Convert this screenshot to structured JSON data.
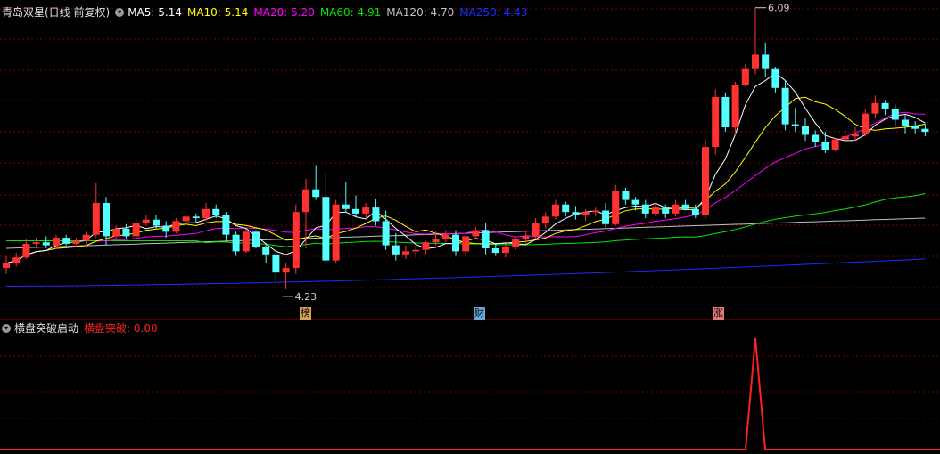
{
  "main_header": {
    "title": "青岛双星(日线 前复权)",
    "ma5": "MA5: 5.14",
    "ma10": "MA10: 5.14",
    "ma20": "MA20: 5.20",
    "ma60": "MA60: 4.91",
    "ma120": "MA120: 4.70",
    "ma250": "MA250: 4.43"
  },
  "sub_header": {
    "title": "横盘突破启动",
    "indicator": "横盘突破: 0.00"
  },
  "badges": [
    {
      "label": "榜",
      "color": "#d8a15c"
    },
    {
      "label": "财",
      "color": "#6aa6d8"
    },
    {
      "label": "涨",
      "color": "#e07a7a"
    }
  ],
  "colors": {
    "up": "#ff3232",
    "down": "#54ffff",
    "ma5": "#ffffff",
    "ma10": "#ffff00",
    "ma20": "#ff00ff",
    "ma60": "#00e600",
    "ma120": "#c0c0c0",
    "ma250": "#1a2cff",
    "grid": "#7a0000",
    "signal": "#ff2020"
  },
  "chart_data": [
    {
      "type": "candlestick",
      "title": "青岛双星(日线 前复权)",
      "annotations": [
        {
          "text": "6.09",
          "kind": "high",
          "value": 6.09
        },
        {
          "text": "4.23",
          "kind": "low",
          "value": 4.23
        }
      ],
      "price_range": [
        4.1,
        6.2
      ],
      "ohlc": [
        [
          4.37,
          4.45,
          4.33,
          4.4
        ],
        [
          4.4,
          4.47,
          4.38,
          4.44
        ],
        [
          4.44,
          4.56,
          4.43,
          4.53
        ],
        [
          4.53,
          4.57,
          4.5,
          4.54
        ],
        [
          4.54,
          4.58,
          4.5,
          4.52
        ],
        [
          4.52,
          4.59,
          4.5,
          4.57
        ],
        [
          4.57,
          4.59,
          4.52,
          4.53
        ],
        [
          4.53,
          4.57,
          4.51,
          4.55
        ],
        [
          4.55,
          4.61,
          4.53,
          4.59
        ],
        [
          4.59,
          4.93,
          4.57,
          4.8
        ],
        [
          4.8,
          4.84,
          4.52,
          4.58
        ],
        [
          4.58,
          4.65,
          4.56,
          4.63
        ],
        [
          4.63,
          4.66,
          4.56,
          4.58
        ],
        [
          4.58,
          4.7,
          4.57,
          4.67
        ],
        [
          4.67,
          4.72,
          4.65,
          4.69
        ],
        [
          4.69,
          4.72,
          4.63,
          4.65
        ],
        [
          4.65,
          4.68,
          4.57,
          4.61
        ],
        [
          4.61,
          4.7,
          4.6,
          4.68
        ],
        [
          4.68,
          4.73,
          4.67,
          4.71
        ],
        [
          4.71,
          4.73,
          4.67,
          4.7
        ],
        [
          4.7,
          4.8,
          4.68,
          4.76
        ],
        [
          4.76,
          4.79,
          4.7,
          4.72
        ],
        [
          4.72,
          4.74,
          4.55,
          4.59
        ],
        [
          4.59,
          4.61,
          4.45,
          4.48
        ],
        [
          4.48,
          4.63,
          4.47,
          4.61
        ],
        [
          4.61,
          4.62,
          4.5,
          4.51
        ],
        [
          4.51,
          4.53,
          4.4,
          4.46
        ],
        [
          4.46,
          4.48,
          4.3,
          4.34
        ],
        [
          4.34,
          4.4,
          4.23,
          4.37
        ],
        [
          4.37,
          4.79,
          4.33,
          4.74
        ],
        [
          4.74,
          4.96,
          4.5,
          4.89
        ],
        [
          4.89,
          5.05,
          4.82,
          4.84
        ],
        [
          4.84,
          5.01,
          4.4,
          4.42
        ],
        [
          4.42,
          4.82,
          4.4,
          4.79
        ],
        [
          4.79,
          4.94,
          4.74,
          4.76
        ],
        [
          4.76,
          4.85,
          4.71,
          4.73
        ],
        [
          4.73,
          4.8,
          4.7,
          4.77
        ],
        [
          4.77,
          4.83,
          4.65,
          4.68
        ],
        [
          4.68,
          4.75,
          4.49,
          4.52
        ],
        [
          4.52,
          4.6,
          4.42,
          4.46
        ],
        [
          4.46,
          4.52,
          4.43,
          4.48
        ],
        [
          4.48,
          4.52,
          4.44,
          4.49
        ],
        [
          4.49,
          4.55,
          4.46,
          4.54
        ],
        [
          4.54,
          4.61,
          4.52,
          4.56
        ],
        [
          4.56,
          4.62,
          4.54,
          4.59
        ],
        [
          4.59,
          4.62,
          4.45,
          4.48
        ],
        [
          4.48,
          4.6,
          4.45,
          4.58
        ],
        [
          4.58,
          4.64,
          4.56,
          4.62
        ],
        [
          4.62,
          4.67,
          4.46,
          4.5
        ],
        [
          4.5,
          4.53,
          4.45,
          4.47
        ],
        [
          4.47,
          4.53,
          4.44,
          4.51
        ],
        [
          4.51,
          4.58,
          4.49,
          4.56
        ],
        [
          4.56,
          4.62,
          4.53,
          4.58
        ],
        [
          4.58,
          4.7,
          4.56,
          4.67
        ],
        [
          4.67,
          4.74,
          4.63,
          4.71
        ],
        [
          4.71,
          4.82,
          4.69,
          4.79
        ],
        [
          4.79,
          4.81,
          4.71,
          4.74
        ],
        [
          4.74,
          4.78,
          4.69,
          4.72
        ],
        [
          4.72,
          4.76,
          4.68,
          4.74
        ],
        [
          4.74,
          4.77,
          4.71,
          4.75
        ],
        [
          4.75,
          4.8,
          4.64,
          4.66
        ],
        [
          4.66,
          4.92,
          4.65,
          4.88
        ],
        [
          4.88,
          4.9,
          4.79,
          4.82
        ],
        [
          4.82,
          4.84,
          4.75,
          4.79
        ],
        [
          4.79,
          4.82,
          4.7,
          4.73
        ],
        [
          4.73,
          4.8,
          4.71,
          4.77
        ],
        [
          4.77,
          4.79,
          4.7,
          4.73
        ],
        [
          4.73,
          4.82,
          4.71,
          4.79
        ],
        [
          4.79,
          4.82,
          4.75,
          4.76
        ],
        [
          4.76,
          4.79,
          4.7,
          4.72
        ],
        [
          4.72,
          5.22,
          4.7,
          5.17
        ],
        [
          5.17,
          5.55,
          5.12,
          5.5
        ],
        [
          5.5,
          5.53,
          5.27,
          5.3
        ],
        [
          5.3,
          5.6,
          5.25,
          5.58
        ],
        [
          5.58,
          5.72,
          5.57,
          5.69
        ],
        [
          5.69,
          6.09,
          5.65,
          5.78
        ],
        [
          5.78,
          5.86,
          5.63,
          5.69
        ],
        [
          5.69,
          5.7,
          5.53,
          5.56
        ],
        [
          5.56,
          5.61,
          5.28,
          5.32
        ],
        [
          5.32,
          5.43,
          5.27,
          5.31
        ],
        [
          5.31,
          5.36,
          5.21,
          5.25
        ],
        [
          5.25,
          5.28,
          5.17,
          5.2
        ],
        [
          5.2,
          5.27,
          5.13,
          5.15
        ],
        [
          5.15,
          5.23,
          5.14,
          5.22
        ],
        [
          5.22,
          5.28,
          5.2,
          5.24
        ],
        [
          5.24,
          5.3,
          5.21,
          5.26
        ],
        [
          5.26,
          5.42,
          5.24,
          5.39
        ],
        [
          5.39,
          5.51,
          5.36,
          5.46
        ],
        [
          5.46,
          5.48,
          5.38,
          5.42
        ],
        [
          5.42,
          5.45,
          5.31,
          5.35
        ],
        [
          5.35,
          5.38,
          5.26,
          5.31
        ],
        [
          5.31,
          5.34,
          5.26,
          5.29
        ],
        [
          5.29,
          5.32,
          5.24,
          5.27
        ]
      ]
    },
    {
      "type": "line",
      "title": "横盘突破启动",
      "series": [
        {
          "name": "横盘突破",
          "spike_index": 75,
          "values_note_free": true
        }
      ]
    }
  ]
}
